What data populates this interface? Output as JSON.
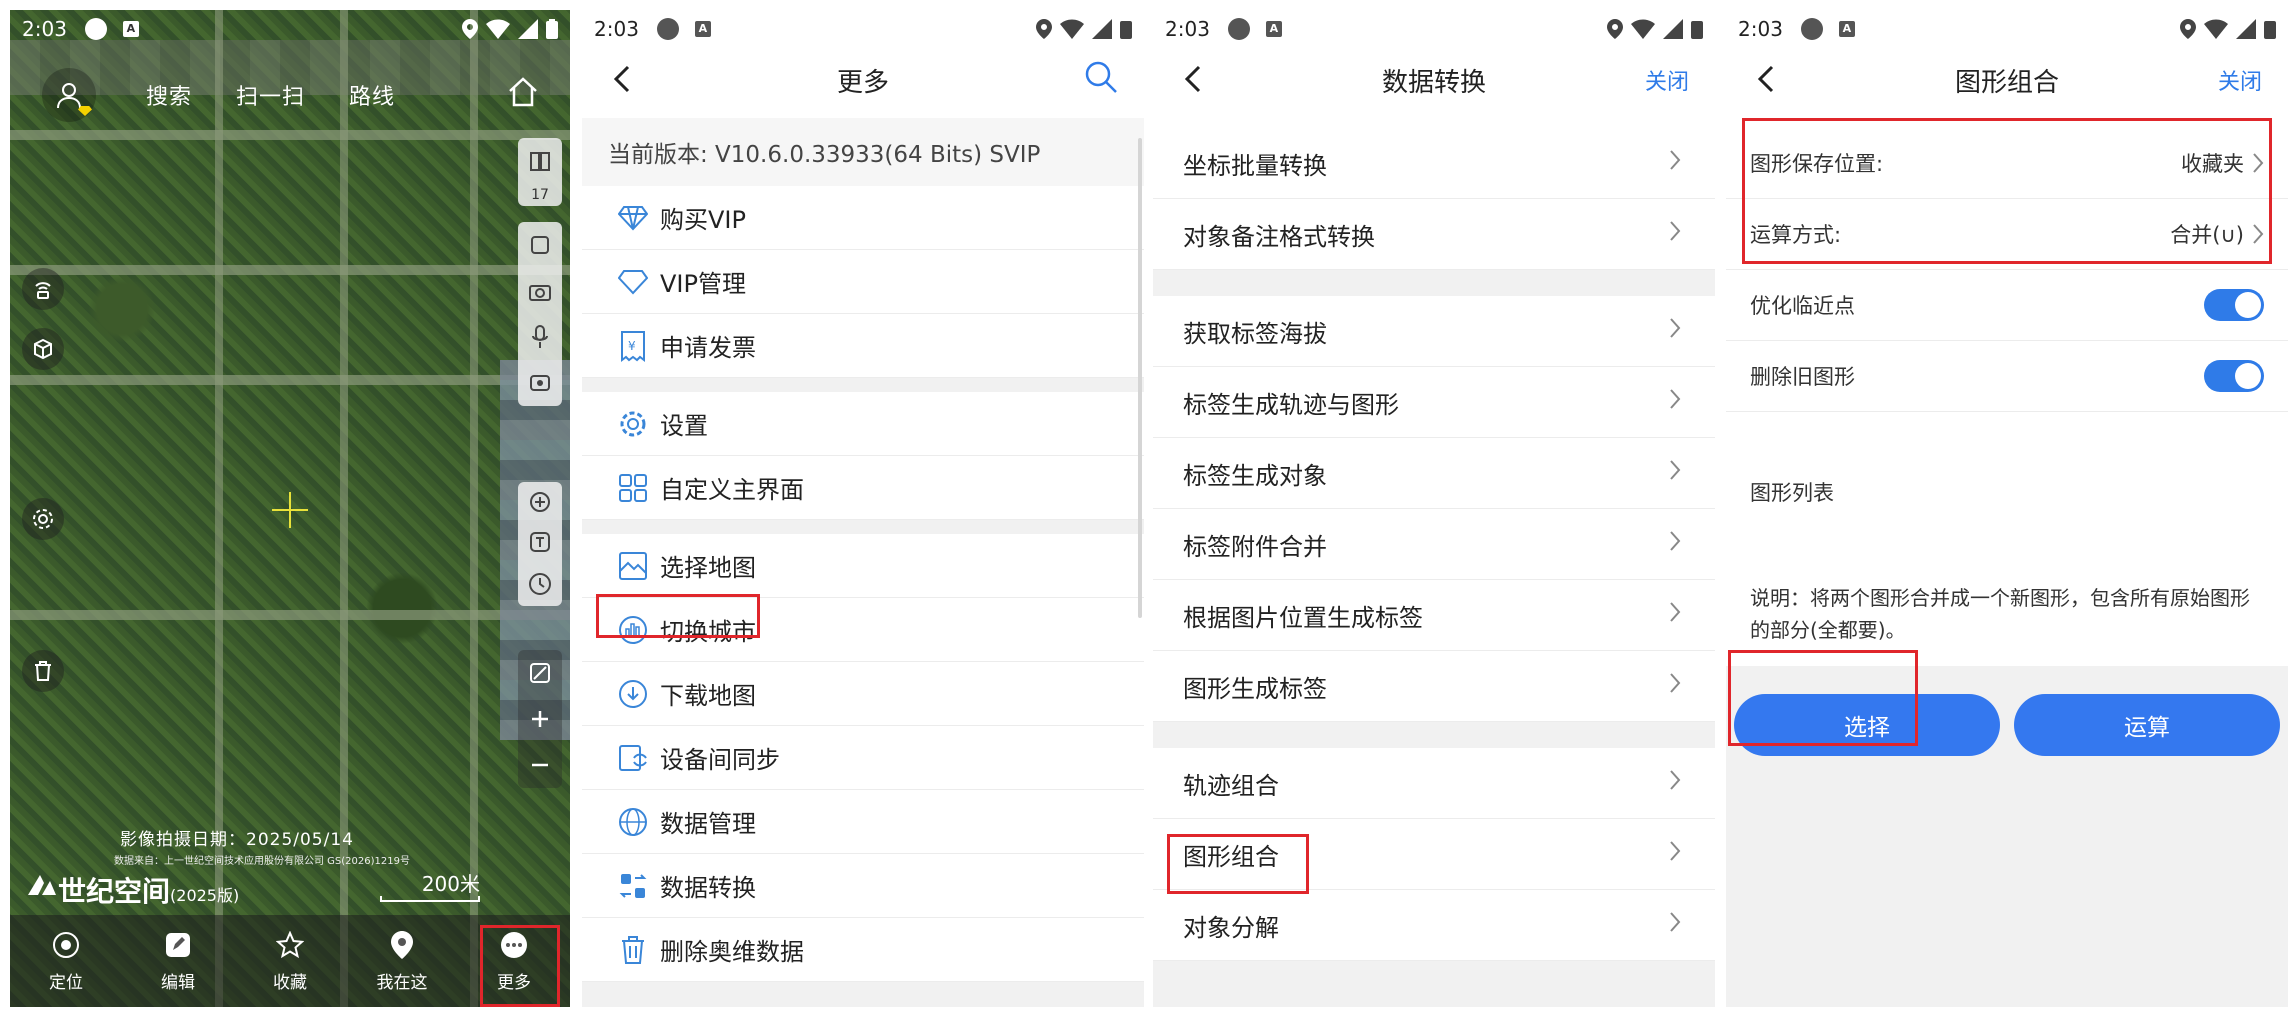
{
  "status_bar": {
    "time": "2:03"
  },
  "map_screen": {
    "top_nav": [
      "搜索",
      "扫一扫",
      "路线"
    ],
    "zoom_level": "17",
    "capture_date": "影像拍摄日期：2025/05/14",
    "credit": "数据来自：上一世纪空间技术应用股份有限公司 GS(2026)1219号",
    "brand": "世纪空间",
    "brand_year": "(2025版)",
    "scale": "200米",
    "bottom_nav": [
      "定位",
      "编辑",
      "收藏",
      "我在这",
      "更多"
    ]
  },
  "more_screen": {
    "title": "更多",
    "version": "当前版本: V10.6.0.33933(64 Bits) SVIP",
    "groups": [
      [
        "购买VIP",
        "VIP管理",
        "申请发票"
      ],
      [
        "设置",
        "自定义主界面"
      ],
      [
        "选择地图",
        "切换城市",
        "下载地图",
        "设备间同步",
        "数据管理",
        "数据转换",
        "删除奥维数据"
      ]
    ]
  },
  "convert_screen": {
    "title": "数据转换",
    "close": "关闭",
    "groups": [
      [
        "坐标批量转换",
        "对象备注格式转换"
      ],
      [
        "获取标签海拔",
        "标签生成轨迹与图形",
        "标签生成对象",
        "标签附件合并",
        "根据图片位置生成标签",
        "图形生成标签"
      ],
      [
        "轨迹组合",
        "图形组合",
        "对象分解"
      ]
    ]
  },
  "combine_screen": {
    "title": "图形组合",
    "close": "关闭",
    "save_location_label": "图形保存位置:",
    "save_location_value": "收藏夹",
    "operation_label": "运算方式:",
    "operation_value": "合并(∪)",
    "optimize_label": "优化临近点",
    "delete_label": "删除旧图形",
    "list_label": "图形列表",
    "note": "说明：将两个图形合并成一个新图形，包含所有原始图形的部分(全都要)。",
    "select_button": "选择",
    "compute_button": "运算"
  },
  "colors": {
    "accent": "#3478ef",
    "highlight": "#e0262b"
  }
}
